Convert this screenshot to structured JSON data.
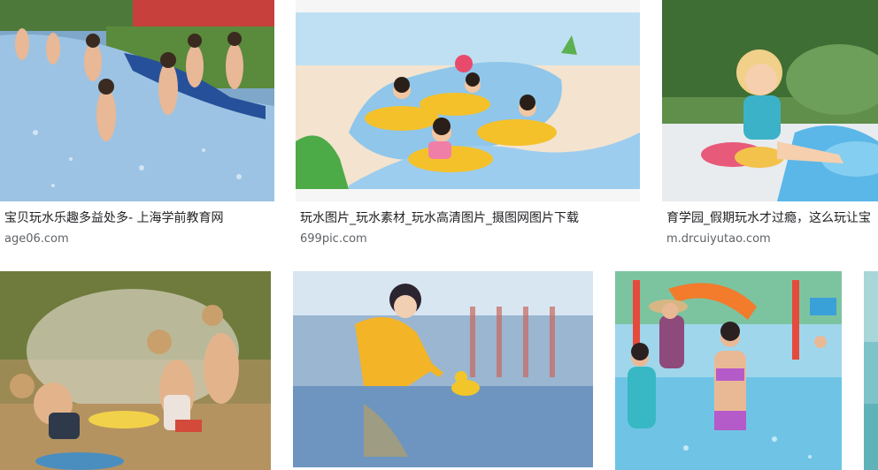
{
  "results": [
    {
      "caption": "宝贝玩水乐趣多益处多- 上海学前教育网",
      "source": "age06.com",
      "image_subject": "toddlers-playing-in-shallow-pool"
    },
    {
      "caption": "玩水图片_玩水素材_玩水高清图片_摄图网图片下载",
      "source": "699pic.com",
      "image_subject": "cartoon-kids-on-water-slide"
    },
    {
      "caption": "育学园_假期玩水才过瘾，这么玩让宝",
      "source": "m.drcuiyutao.com",
      "image_subject": "girl-sitting-in-splash-water"
    },
    {
      "caption": "",
      "source": "",
      "image_subject": "kids-playing-with-sprinkler"
    },
    {
      "caption": "",
      "source": "",
      "image_subject": "girl-in-yellow-raincoat-with-duck"
    },
    {
      "caption": "",
      "source": "",
      "image_subject": "kids-in-water-park-pool"
    }
  ],
  "colors": {
    "caption_text": "#202124",
    "source_text": "#5f6368",
    "background": "#ffffff"
  }
}
